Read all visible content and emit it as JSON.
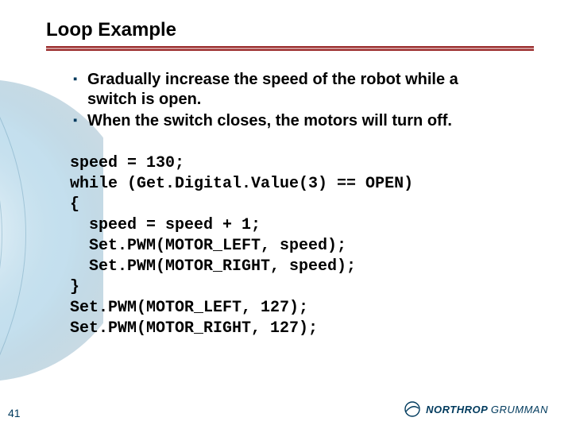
{
  "title": "Loop Example",
  "bullets": [
    "Gradually increase the speed of the robot while a switch is open.",
    "When the switch closes, the motors will turn off."
  ],
  "code_lines": [
    "speed = 130;",
    "while (Get.Digital.Value(3) == OPEN)",
    "{",
    "  speed = speed + 1;",
    "  Set.PWM(MOTOR_LEFT, speed);",
    "  Set.PWM(MOTOR_RIGHT, speed);",
    "}",
    "Set.PWM(MOTOR_LEFT, 127);",
    "Set.PWM(MOTOR_RIGHT, 127);"
  ],
  "page_number": "41",
  "logo": {
    "part1": "NORTHROP",
    "part2": "GRUMMAN"
  }
}
